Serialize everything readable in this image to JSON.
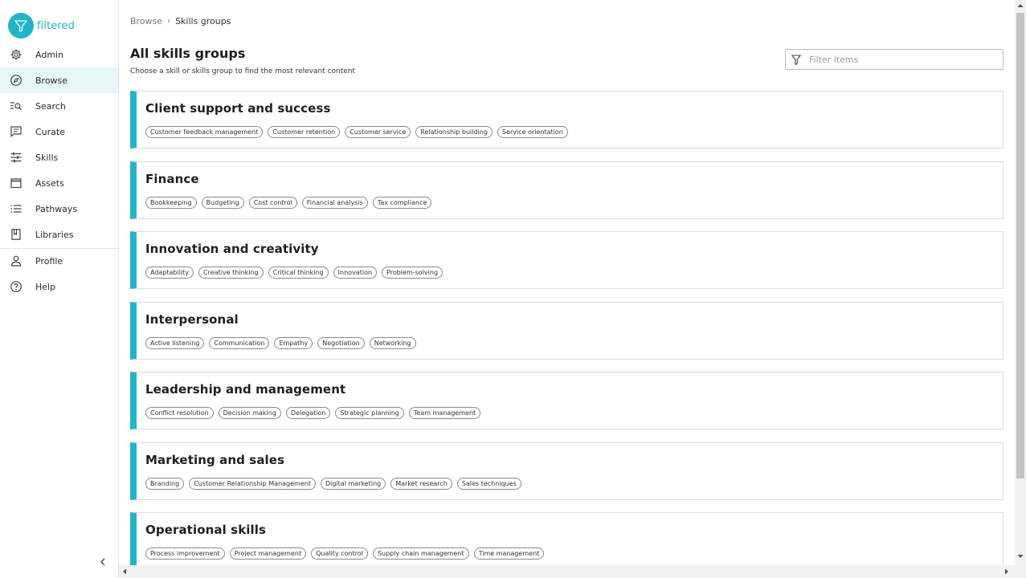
{
  "brand": {
    "name": "filtered",
    "accent": "#1fb6c9"
  },
  "nav": {
    "items": [
      {
        "label": "Admin",
        "icon": "gear-icon"
      },
      {
        "label": "Browse",
        "icon": "compass-icon",
        "active": true
      },
      {
        "label": "Search",
        "icon": "search-icon"
      },
      {
        "label": "Curate",
        "icon": "chat-icon"
      },
      {
        "label": "Skills",
        "icon": "sliders-icon"
      },
      {
        "label": "Assets",
        "icon": "window-icon"
      },
      {
        "label": "Pathways",
        "icon": "list-icon"
      },
      {
        "label": "Libraries",
        "icon": "book-icon"
      },
      {
        "label": "Profile",
        "icon": "person-icon"
      },
      {
        "label": "Help",
        "icon": "help-icon"
      }
    ]
  },
  "breadcrumb": {
    "root": "Browse",
    "separator": "›",
    "current": "Skills groups"
  },
  "header": {
    "title": "All skills groups",
    "subtitle": "Choose a skill or skills group to find the most relevant content"
  },
  "filter": {
    "placeholder": "Filter items",
    "value": ""
  },
  "groups": [
    {
      "title": "Client support and success",
      "skills": [
        "Customer feedback management",
        "Customer retention",
        "Customer service",
        "Relationship building",
        "Service orientation"
      ]
    },
    {
      "title": "Finance",
      "skills": [
        "Bookkeeping",
        "Budgeting",
        "Cost control",
        "Financial analysis",
        "Tax compliance"
      ]
    },
    {
      "title": "Innovation and creativity",
      "skills": [
        "Adaptability",
        "Creative thinking",
        "Critical thinking",
        "Innovation",
        "Problem-solving"
      ]
    },
    {
      "title": "Interpersonal",
      "skills": [
        "Active listening",
        "Communication",
        "Empathy",
        "Negotiation",
        "Networking"
      ]
    },
    {
      "title": "Leadership and management",
      "skills": [
        "Conflict resolution",
        "Decision making",
        "Delegation",
        "Strategic planning",
        "Team management"
      ]
    },
    {
      "title": "Marketing and sales",
      "skills": [
        "Branding",
        "Customer Relationship Management",
        "Digital marketing",
        "Market research",
        "Sales techniques"
      ]
    },
    {
      "title": "Operational skills",
      "skills": [
        "Process improvement",
        "Project management",
        "Quality control",
        "Supply chain management",
        "Time management"
      ]
    }
  ]
}
